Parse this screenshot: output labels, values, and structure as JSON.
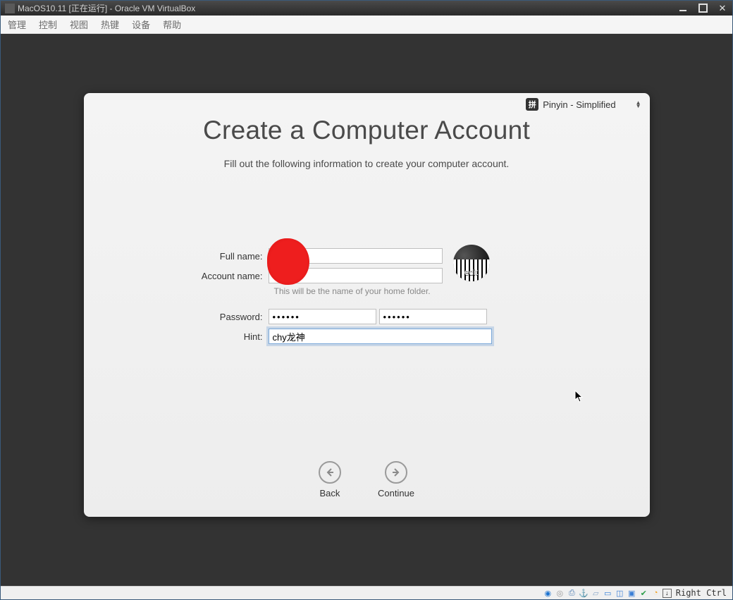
{
  "window": {
    "title": "MacOS10.11 [正在运行] - Oracle VM VirtualBox"
  },
  "menubar": {
    "items": [
      "管理",
      "控制",
      "视图",
      "热键",
      "设备",
      "帮助"
    ]
  },
  "ime": {
    "icon_label": "拼",
    "label": "Pinyin - Simplified"
  },
  "dialog": {
    "title": "Create a Computer Account",
    "subtitle": "Fill out the following information to create your computer account.",
    "labels": {
      "full_name": "Full name:",
      "account_name": "Account name:",
      "password": "Password:",
      "hint": "Hint:"
    },
    "helper": "This will be the name of your home folder.",
    "values": {
      "full_name": "",
      "account_name": "",
      "password1": "••••••",
      "password2": "••••••",
      "hint": "chy龙神"
    },
    "avatar_label": "edit",
    "back_label": "Back",
    "continue_label": "Continue"
  },
  "statusbar": {
    "host_key": "Right Ctrl"
  }
}
